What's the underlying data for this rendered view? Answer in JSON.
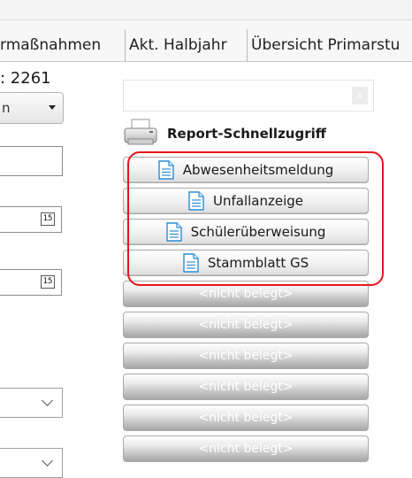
{
  "tabs": [
    {
      "label": "rmaßnahmen"
    },
    {
      "label": "Akt. Halbjahr"
    },
    {
      "label": "Übersicht Primarstu"
    }
  ],
  "left": {
    "number_text": ": 2261",
    "dropdown_value": "n",
    "calendar_label": "15"
  },
  "report": {
    "title": "Report-Schnellzugriff",
    "buttons": [
      {
        "label": "Abwesenheitsmeldung",
        "icon": "document-icon"
      },
      {
        "label": "Unfallanzeige",
        "icon": "document-icon"
      },
      {
        "label": "Schülerüberweisung",
        "icon": "document-icon"
      },
      {
        "label": "Stammblatt GS",
        "icon": "document-icon"
      }
    ],
    "empty_label": "<nicht belegt>",
    "search_clear": "x"
  },
  "colors": {
    "highlight": "#e8141b",
    "doc_icon_blue": "#2a8dd4"
  }
}
